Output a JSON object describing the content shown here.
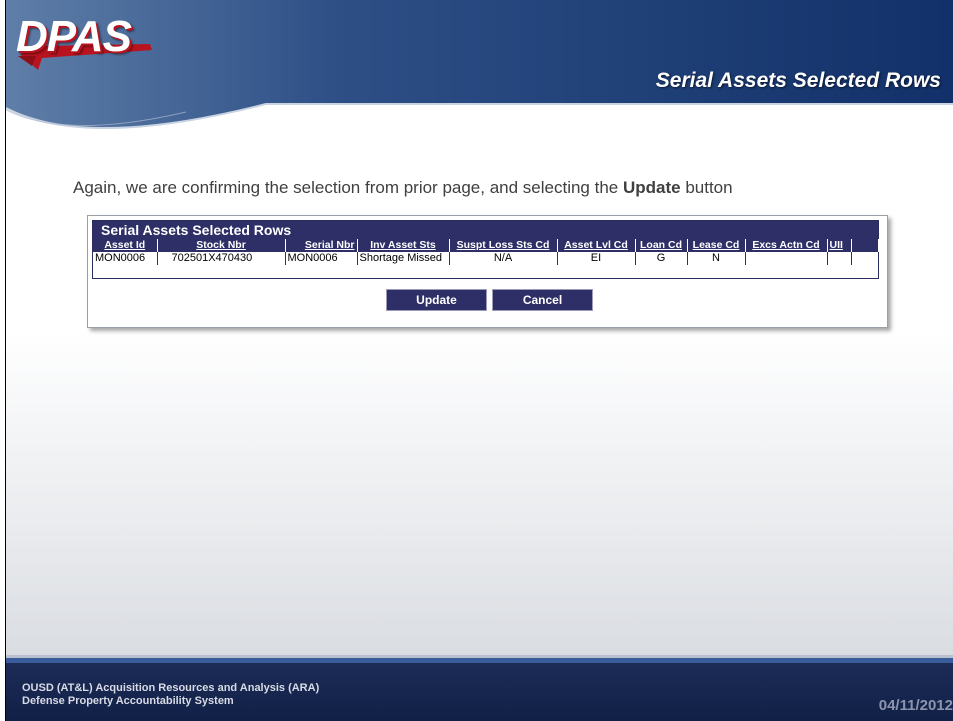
{
  "header": {
    "logo_text": "DPAS",
    "slide_title": "Serial Assets Selected Rows"
  },
  "instruction": {
    "text_before": "Again, we are confirming the selection from prior page, and selecting the ",
    "bold_word": "Update",
    "text_after": " button"
  },
  "panel": {
    "title": "Serial Assets Selected Rows",
    "columns": [
      "Asset Id",
      "Stock Nbr",
      "Serial Nbr",
      "Inv Asset Sts",
      "Suspt Loss Sts Cd",
      "Asset Lvl Cd",
      "Loan Cd",
      "Lease Cd",
      "Excs Actn Cd",
      "UII"
    ],
    "rows": [
      [
        "MON0006",
        "702501X470430",
        "MON0006",
        "Shortage Missed",
        "N/A",
        "EI",
        "G",
        "N",
        "",
        ""
      ]
    ],
    "update_label": "Update",
    "cancel_label": "Cancel"
  },
  "footer": {
    "org_line1": "OUSD (AT&L) Acquisition Resources and Analysis (ARA)",
    "org_line2": "Defense Property Accountability System",
    "date": "04/11/2012"
  },
  "colors": {
    "header_navy": "#1b3466",
    "panel_navy": "#2d2f66",
    "logo_red": "#b8131f"
  }
}
